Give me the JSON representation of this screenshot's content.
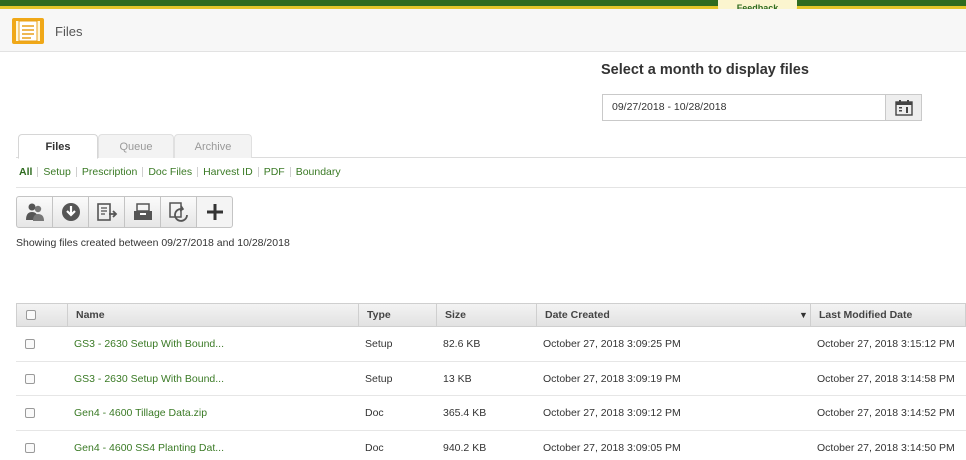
{
  "feedback_label": "Feedback",
  "header": {
    "title": "Files"
  },
  "date_picker": {
    "heading": "Select a month to display files",
    "range_value": "09/27/2018 - 10/28/2018"
  },
  "tabs": [
    {
      "label": "Files",
      "active": true
    },
    {
      "label": "Queue",
      "active": false
    },
    {
      "label": "Archive",
      "active": false
    }
  ],
  "filters": [
    "All",
    "Setup",
    "Prescription",
    "Doc Files",
    "Harvest ID",
    "PDF",
    "Boundary"
  ],
  "toolbar": {
    "icons": [
      "share-users-icon",
      "download-icon",
      "export-icon",
      "archive-tray-icon",
      "refresh-file-icon",
      "add-icon"
    ]
  },
  "showing_text": "Showing files created between 09/27/2018 and 10/28/2018",
  "table": {
    "columns": [
      "Name",
      "Type",
      "Size",
      "Date Created",
      "Last Modified Date"
    ],
    "sort_indicator": "▼",
    "rows": [
      {
        "name": "GS3 - 2630 Setup With Bound...",
        "type": "Setup",
        "size": "82.6 KB",
        "created": "October 27, 2018 3:09:25 PM",
        "modified": "October 27, 2018 3:15:12 PM"
      },
      {
        "name": "GS3 - 2630 Setup With Bound...",
        "type": "Setup",
        "size": "13 KB",
        "created": "October 27, 2018 3:09:19 PM",
        "modified": "October 27, 2018 3:14:58 PM"
      },
      {
        "name": "Gen4 - 4600 Tillage Data.zip",
        "type": "Doc",
        "size": "365.4 KB",
        "created": "October 27, 2018 3:09:12 PM",
        "modified": "October 27, 2018 3:14:52 PM"
      },
      {
        "name": "Gen4 - 4600 SS4 Planting Dat...",
        "type": "Doc",
        "size": "940.2 KB",
        "created": "October 27, 2018 3:09:05 PM",
        "modified": "October 27, 2018 3:14:50 PM"
      }
    ]
  },
  "colors": {
    "brand_green": "#2e6b1f",
    "accent_yellow": "#e3c62a",
    "link_green": "#3a7a25"
  }
}
